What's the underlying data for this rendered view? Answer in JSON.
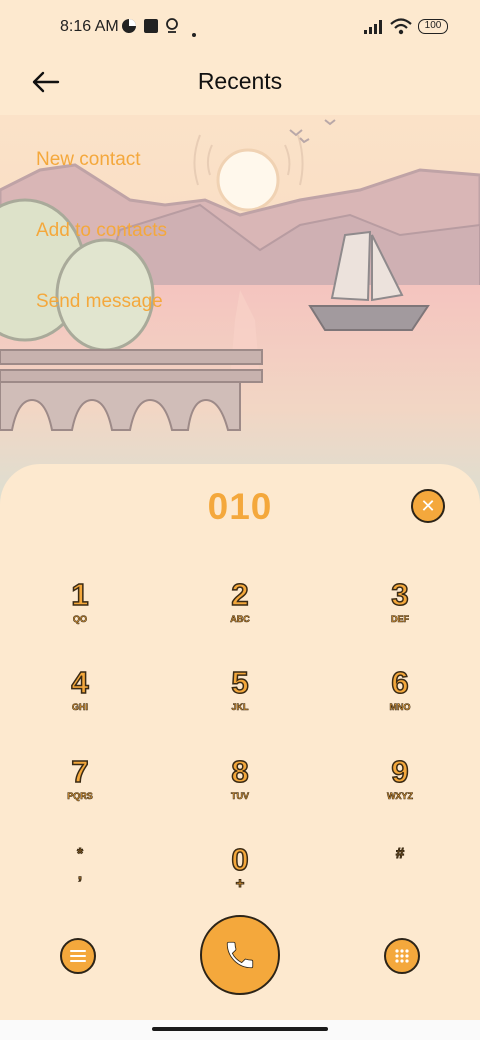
{
  "status": {
    "time": "8:16 AM",
    "battery": "100"
  },
  "header": {
    "title": "Recents"
  },
  "menu": {
    "new_contact": "New contact",
    "add_to_contacts": "Add to contacts",
    "send_message": "Send message"
  },
  "dialpad": {
    "number": "010",
    "keys": [
      {
        "digit": "1",
        "letters": "QO"
      },
      {
        "digit": "2",
        "letters": "ABC"
      },
      {
        "digit": "3",
        "letters": "DEF"
      },
      {
        "digit": "4",
        "letters": "GHI"
      },
      {
        "digit": "5",
        "letters": "JKL"
      },
      {
        "digit": "6",
        "letters": "MNO"
      },
      {
        "digit": "7",
        "letters": "PQRS"
      },
      {
        "digit": "8",
        "letters": "TUV"
      },
      {
        "digit": "9",
        "letters": "WXYZ"
      },
      {
        "digit": "*",
        "letters": ","
      },
      {
        "digit": "0",
        "letters": "+"
      },
      {
        "digit": "#",
        "letters": ""
      }
    ]
  },
  "colors": {
    "accent": "#f4a83c",
    "background": "#fde9cf",
    "outline": "#2c2418"
  }
}
